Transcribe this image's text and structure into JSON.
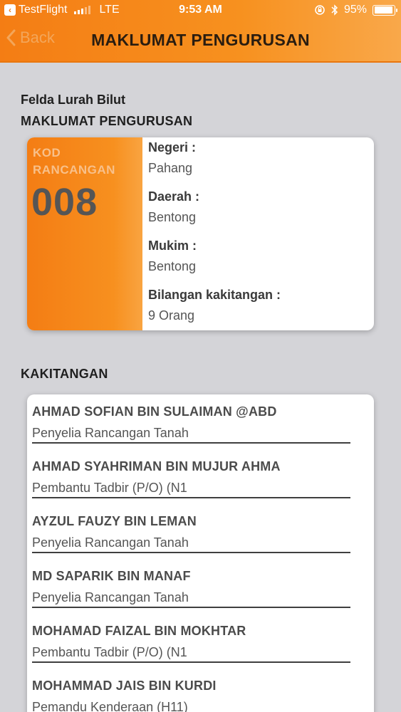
{
  "status_bar": {
    "app_back": "TestFlight",
    "network": "LTE",
    "time": "9:53 AM",
    "battery": "95%",
    "battery_level": 0.95,
    "icons": [
      "lock-rotation-icon",
      "bluetooth-icon",
      "battery-icon"
    ]
  },
  "nav": {
    "back_label": "Back",
    "title": "MAKLUMAT PENGURUSAN"
  },
  "colors": {
    "accent": "#f47d14",
    "background": "#d4d4d8"
  },
  "felda_name": "Felda Lurah Bilut",
  "management": {
    "section_title": "MAKLUMAT PENGURUSAN",
    "kod_label_1": "KOD",
    "kod_label_2": "RANCANGAN",
    "kod_value": "008",
    "fields": [
      {
        "label": "Negeri :",
        "value": "Pahang"
      },
      {
        "label": "Daerah :",
        "value": "Bentong"
      },
      {
        "label": "Mukim :",
        "value": "Bentong"
      },
      {
        "label": "Bilangan kakitangan :",
        "value": "9 Orang"
      }
    ]
  },
  "staff": {
    "section_title": "KAKITANGAN",
    "items": [
      {
        "name": "AHMAD SOFIAN BIN SULAIMAN @ABD",
        "role": "Penyelia Rancangan Tanah"
      },
      {
        "name": "AHMAD SYAHRIMAN BIN MUJUR AHMA",
        "role": "Pembantu Tadbir (P/O) (N1"
      },
      {
        "name": "AYZUL FAUZY BIN LEMAN",
        "role": "Penyelia Rancangan Tanah"
      },
      {
        "name": "MD SAPARIK BIN MANAF",
        "role": "Penyelia Rancangan Tanah"
      },
      {
        "name": "MOHAMAD FAIZAL BIN MOKHTAR",
        "role": "Pembantu Tadbir (P/O) (N1"
      },
      {
        "name": "MOHAMMAD JAIS BIN KURDI",
        "role": "Pemandu Kenderaan (H11)"
      }
    ]
  }
}
